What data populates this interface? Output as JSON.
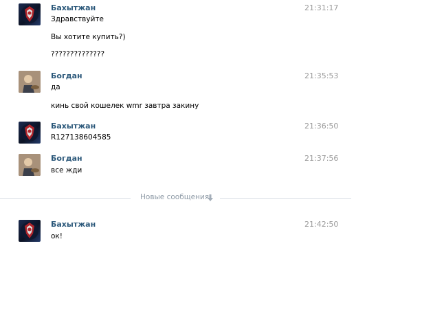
{
  "messages": [
    {
      "author": "Бахытжан",
      "time": "21:31:17",
      "avatar_icon": "dark-red-emblem-avatar",
      "lines": [
        "Здравствуйте",
        "Вы хотите купить?)",
        "??????????????"
      ]
    },
    {
      "author": "Богдан",
      "time": "21:35:53",
      "avatar_icon": "photo-avatar",
      "lines": [
        "да",
        "кинь свой кошелек wmr завтра закину"
      ]
    },
    {
      "author": "Бахытжан",
      "time": "21:36:50",
      "avatar_icon": "dark-red-emblem-avatar",
      "lines": [
        "R127138604585"
      ]
    },
    {
      "author": "Богдан",
      "time": "21:37:56",
      "avatar_icon": "photo-avatar",
      "lines": [
        "все жди"
      ]
    },
    {
      "author": "Бахытжан",
      "time": "21:42:50",
      "avatar_icon": "dark-red-emblem-avatar",
      "lines": [
        "ок!"
      ]
    }
  ],
  "divider": {
    "label": "Новые сообщения",
    "icon": "arrow-down-icon"
  },
  "colors": {
    "author": "#2b587a",
    "time": "#999999",
    "divider_line": "#d7dde4",
    "divider_text": "#8e9aa6"
  }
}
